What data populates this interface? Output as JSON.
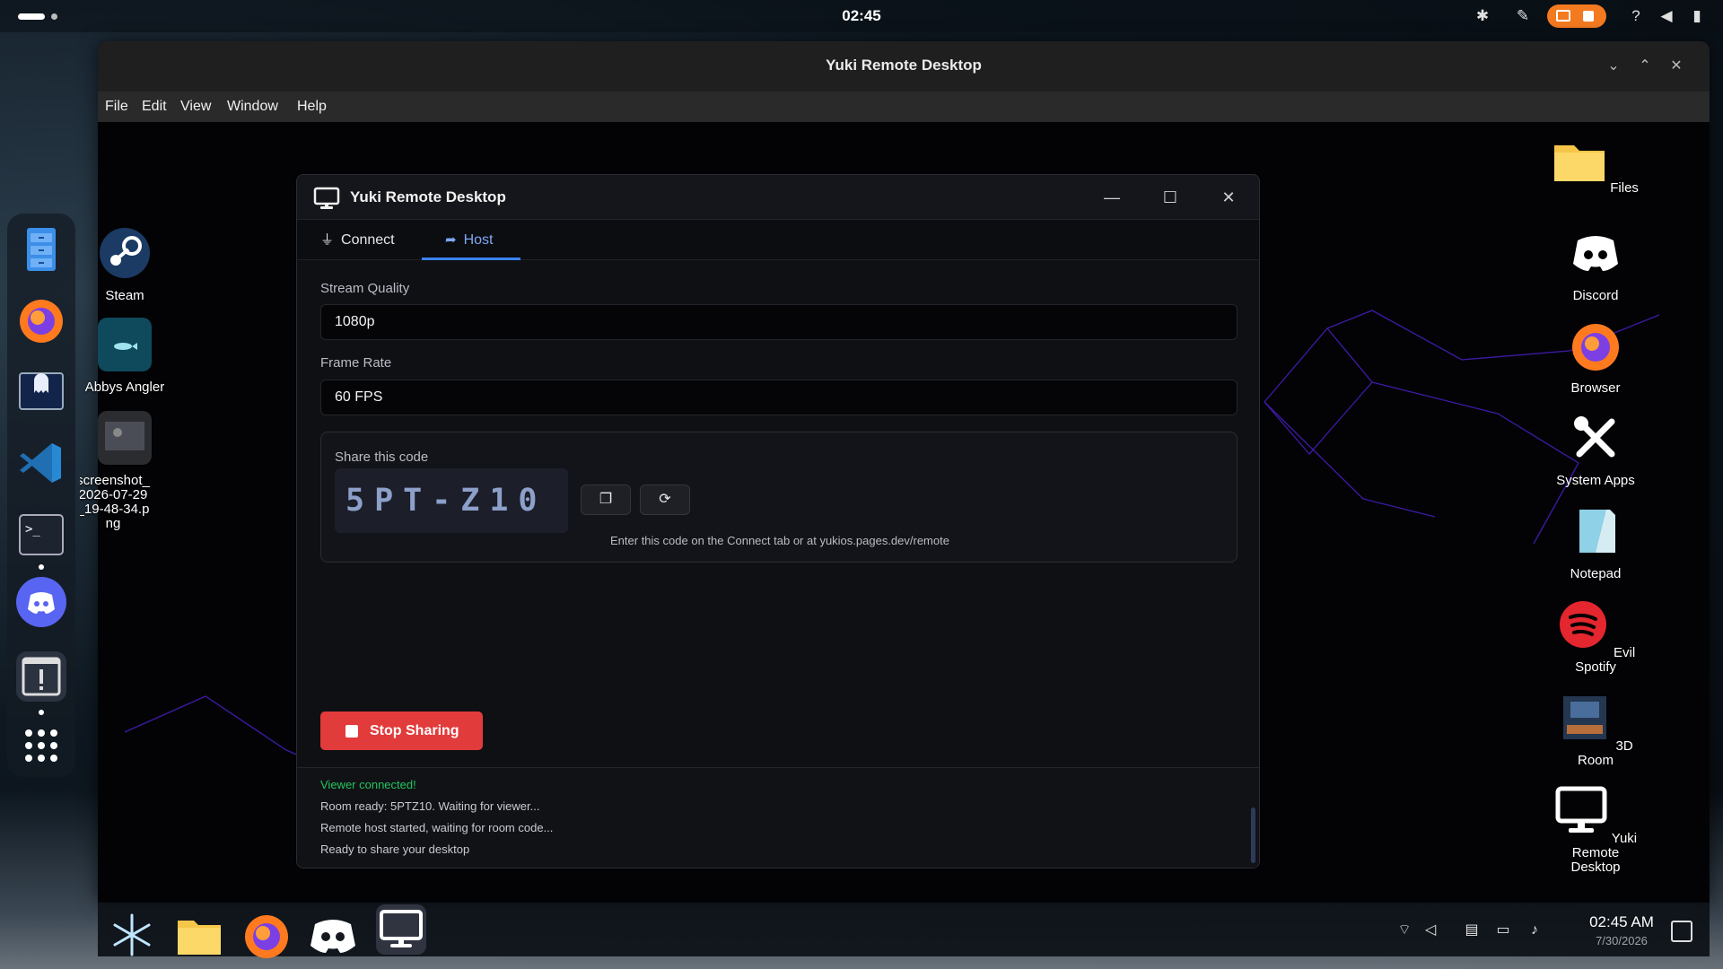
{
  "top_bar": {
    "clock": "02:45"
  },
  "desktop_icons": [
    {
      "label": "Steam",
      "icon": "steam-icon"
    },
    {
      "label": "Abbys Angler",
      "icon": "fish-game-icon"
    },
    {
      "label": "screenshot_2026-07-29_19-48-34.png",
      "icon": "image-file-icon"
    },
    {
      "label": "Files",
      "icon": "folder-icon"
    },
    {
      "label": "Discord",
      "icon": "discord-icon"
    },
    {
      "label": "Browser",
      "icon": "firefox-icon"
    },
    {
      "label": "System Apps",
      "icon": "tools-icon"
    },
    {
      "label": "Notepad",
      "icon": "notepad-icon"
    },
    {
      "label": "Evil Spotify",
      "icon": "spotify-icon"
    },
    {
      "label": "3D Room",
      "icon": "3d-room-icon"
    },
    {
      "label": "Yuki Remote Desktop",
      "icon": "monitor-icon"
    }
  ],
  "main_window": {
    "title": "Yuki Remote Desktop",
    "menu": [
      "File",
      "Edit",
      "View",
      "Window",
      "Help"
    ]
  },
  "dialog": {
    "title": "Yuki Remote Desktop",
    "tabs": [
      {
        "label": "Connect",
        "icon": "plug-icon",
        "active": false
      },
      {
        "label": "Host",
        "icon": "share-arrow-icon",
        "active": true
      }
    ],
    "stream_quality": {
      "label": "Stream Quality",
      "value": "1080p"
    },
    "frame_rate": {
      "label": "Frame Rate",
      "value": "60 FPS"
    },
    "share": {
      "label": "Share this code",
      "code": "5PT-Z10",
      "hint": "Enter this code on the Connect tab or at yukios.pages.dev/remote"
    },
    "stop_button": "Stop Sharing",
    "log": [
      {
        "text": "Viewer connected!",
        "status": "success"
      },
      {
        "text": "Room ready: 5PTZ10. Waiting for viewer...",
        "status": "info"
      },
      {
        "text": "Remote host started, waiting for room code...",
        "status": "info"
      },
      {
        "text": "Ready to share your desktop",
        "status": "info"
      }
    ]
  },
  "taskbar": {
    "time": "02:45 AM",
    "date": "7/30/2026"
  },
  "colors": {
    "accent_blue": "#3b82f6",
    "stop_red": "#e23b3b",
    "success_green": "#22c55e",
    "record_orange": "#f47a20"
  }
}
